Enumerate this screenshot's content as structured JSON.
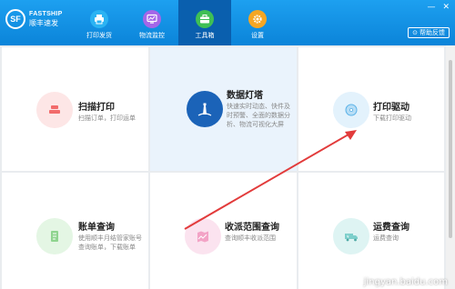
{
  "brand": {
    "logo": "SF",
    "name_en": "FASTSHIP",
    "name_cn": "顺丰速发"
  },
  "nav": [
    {
      "label": "打印发货",
      "icon": "printer-icon",
      "color": "#2bb3f3"
    },
    {
      "label": "物流监控",
      "icon": "monitor-icon",
      "color": "#a466e8"
    },
    {
      "label": "工具箱",
      "icon": "toolbox-icon",
      "color": "#3fbf55"
    },
    {
      "label": "设置",
      "icon": "gear-icon",
      "color": "#f5a623"
    }
  ],
  "window": {
    "minimize": "—",
    "close": "✕"
  },
  "feedback": {
    "label": "帮助反馈"
  },
  "cards": {
    "scan_print": {
      "title": "扫描打印",
      "desc": "扫描订单，打印运单"
    },
    "data_tower": {
      "title": "数据灯塔",
      "desc_lines": [
        "快速实时动态、快件及",
        "时预警、全面的数据分",
        "析、物流可视化大屏"
      ]
    },
    "print_driver": {
      "title": "打印驱动",
      "desc": "下载打印驱动"
    },
    "bill_query": {
      "title": "账单查询",
      "desc_lines": [
        "使用顺丰月结管家账号",
        "查询账单，下载账单"
      ]
    },
    "range_query": {
      "title": "收派范围查询",
      "desc": "查询顺丰收派范围"
    },
    "freight_query": {
      "title": "运费查询",
      "desc": "运费查询"
    }
  },
  "watermark": "jingyan.baidu.com"
}
